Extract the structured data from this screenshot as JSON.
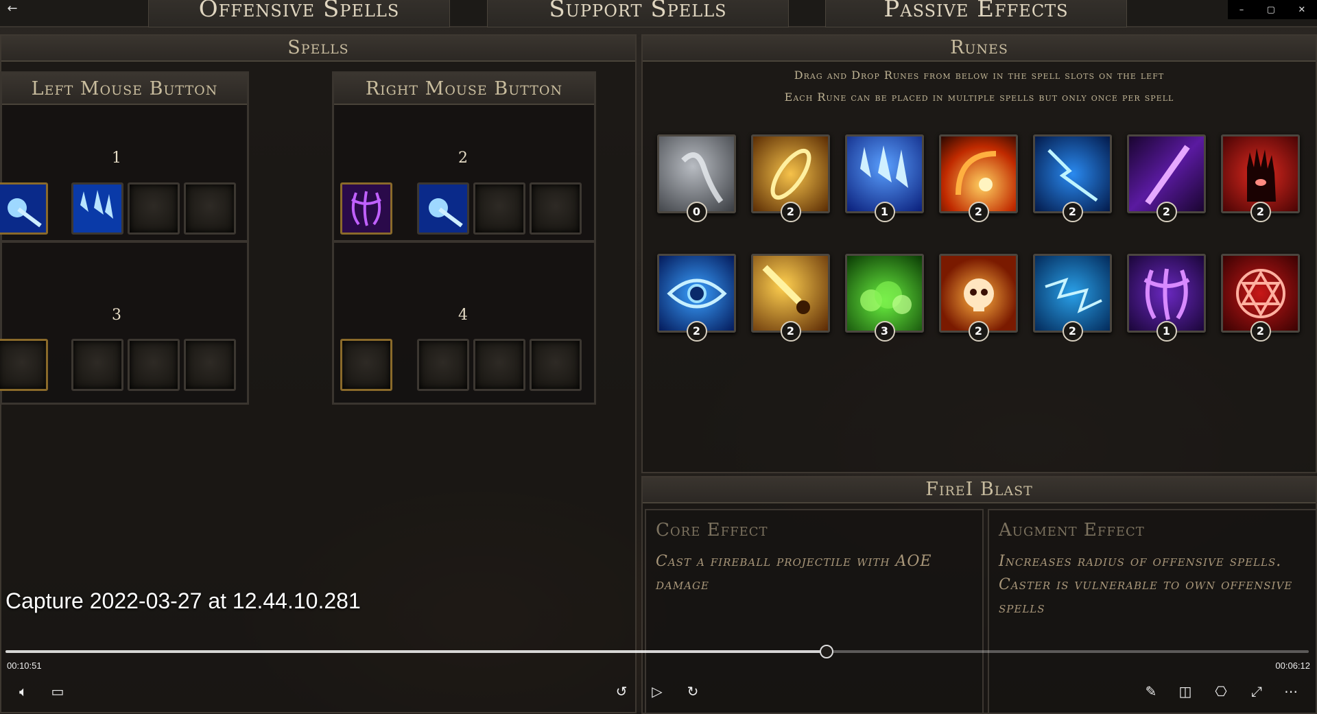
{
  "window": {
    "back_glyph": "←",
    "controls": [
      "–",
      "▢",
      "✕"
    ]
  },
  "tabs": [
    "Offensive Spells",
    "Support Spells",
    "Passive Effects"
  ],
  "spells_panel": {
    "title": "Spells",
    "left": {
      "title": "Left Mouse Button",
      "slots": [
        {
          "number": "1",
          "icons": [
            "frost-orb",
            "ice-shards",
            "",
            ""
          ]
        },
        {
          "number": "3",
          "icons": [
            "",
            "",
            "",
            ""
          ]
        }
      ]
    },
    "right": {
      "title": "Right Mouse Button",
      "slots": [
        {
          "number": "2",
          "icons": [
            "void-tentacles",
            "frost-orb",
            "",
            ""
          ]
        },
        {
          "number": "4",
          "icons": [
            "",
            "",
            "",
            ""
          ]
        }
      ]
    }
  },
  "runes_panel": {
    "title": "Runes",
    "hint_line1": "Drag and Drop Runes from below in the spell slots on the left",
    "hint_line2": "Each Rune can be placed in multiple spells but only once per spell",
    "runes": [
      {
        "name": "ghost-wisp",
        "count": "0",
        "color": "#8a8f96"
      },
      {
        "name": "golden-slash",
        "count": "2",
        "color": "#e0a020"
      },
      {
        "name": "ice-shards",
        "count": "1",
        "color": "#2a66e0"
      },
      {
        "name": "fire-blast",
        "count": "2",
        "color": "#e06a10"
      },
      {
        "name": "lightning",
        "count": "2",
        "color": "#2aa0f0"
      },
      {
        "name": "void-beam",
        "count": "2",
        "color": "#9a30e0"
      },
      {
        "name": "blood-hand",
        "count": "2",
        "color": "#c01818"
      },
      {
        "name": "arcane-eye",
        "count": "2",
        "color": "#1e7ef0"
      },
      {
        "name": "meteor-strike",
        "count": "2",
        "color": "#e0a020"
      },
      {
        "name": "poison-cloud",
        "count": "3",
        "color": "#3ac020"
      },
      {
        "name": "fire-skull",
        "count": "2",
        "color": "#e07010"
      },
      {
        "name": "storm-vortex",
        "count": "2",
        "color": "#20a0e0"
      },
      {
        "name": "void-tentacles",
        "count": "1",
        "color": "#7a30d0"
      },
      {
        "name": "hexagram",
        "count": "2",
        "color": "#d02020"
      }
    ]
  },
  "detail": {
    "title": "FireI  Blast",
    "core_title": "Core Effect",
    "core_text": "Cast a fireball projectile with AOE damage",
    "augment_title": "Augment Effect",
    "augment_text": "Increases radius of offensive spells. Caster is vulnerable to own offensive spells"
  },
  "player": {
    "capture_title": "Capture 2022-03-27 at 12.44.10.281",
    "time_elapsed": "00:10:51",
    "time_remaining": "00:06:12",
    "progress": 0.63
  }
}
